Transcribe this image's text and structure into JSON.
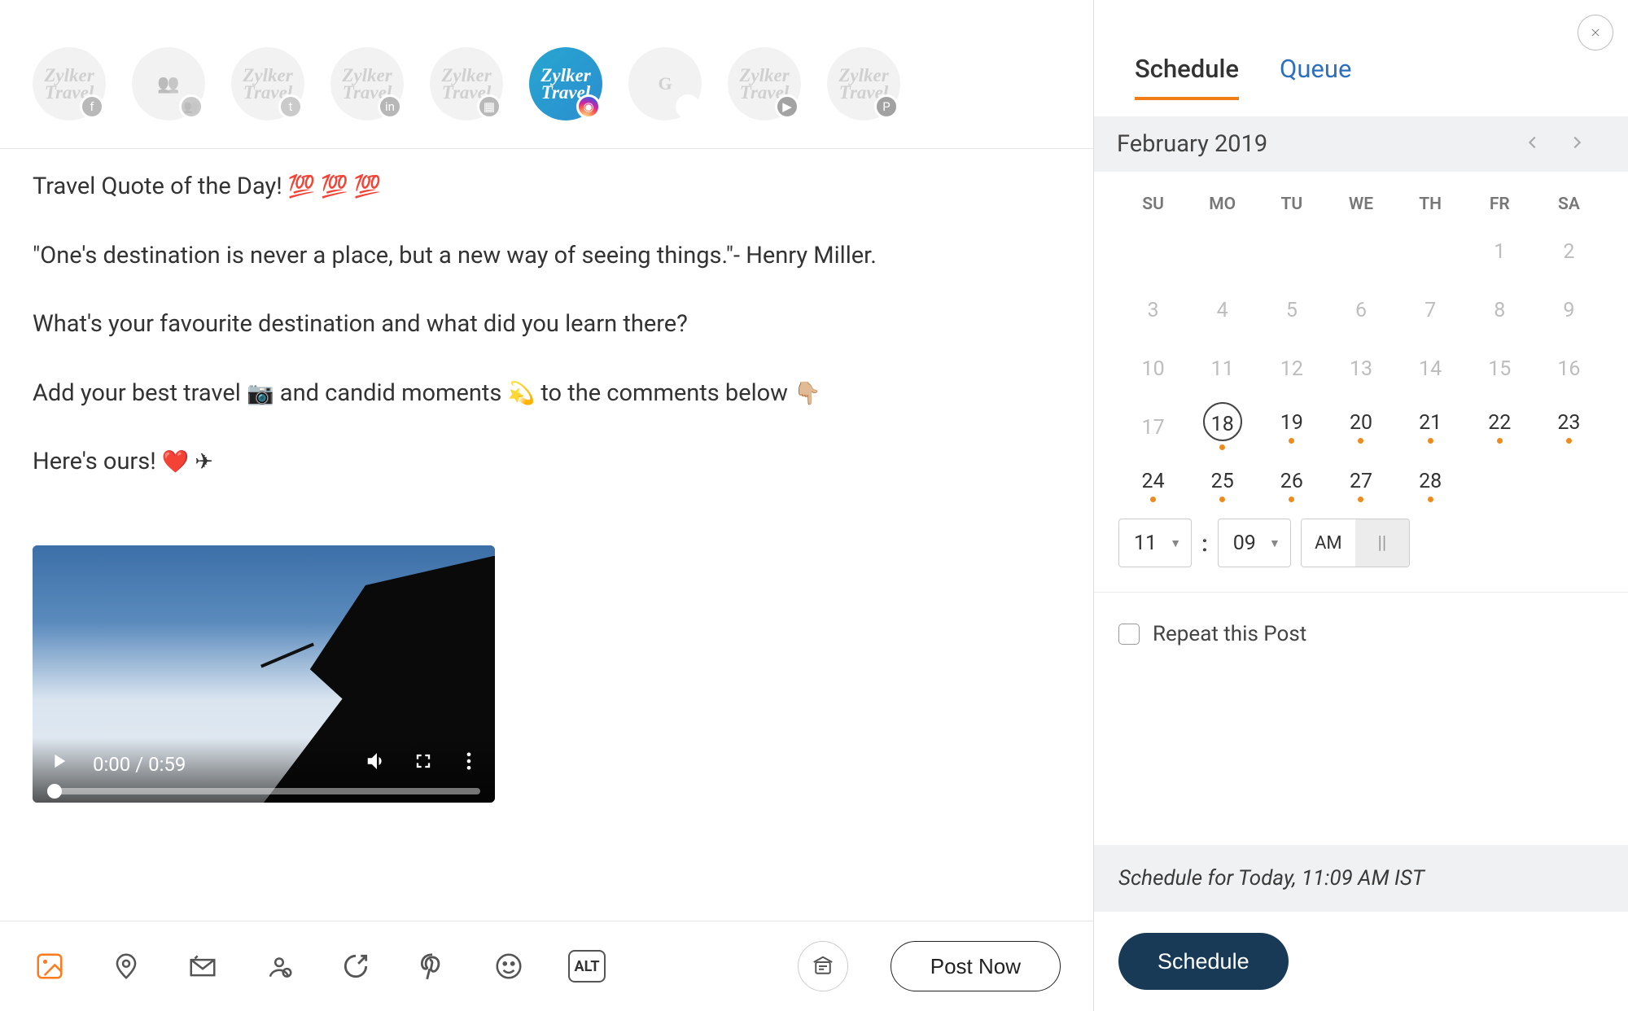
{
  "channels": [
    {
      "name": "Zylker Travel",
      "net": "fb"
    },
    {
      "name": "",
      "net": "grp"
    },
    {
      "name": "Zylker Travel",
      "net": "tw"
    },
    {
      "name": "Zylker Travel",
      "net": "in"
    },
    {
      "name": "Zylker Travel",
      "net": "fbp"
    },
    {
      "name": "Zylker Travel",
      "net": "ig"
    },
    {
      "name": "",
      "net": "gg"
    },
    {
      "name": "Zylker Travel",
      "net": "yt"
    },
    {
      "name": "Zylker Travel",
      "net": "pin"
    }
  ],
  "active_channel_index": 5,
  "compose": {
    "line1_a": "Travel Quote of the Day! ",
    "line1_b": "💯 💯 💯",
    "line2": "\"One's destination is never a place, but a new way of seeing things.\"- Henry Miller.",
    "line3": "What's your favourite destination and what did you learn there?",
    "line4_a": "Add your best travel ",
    "line4_b": "📷",
    "line4_c": "  and candid moments ",
    "line4_d": "💫",
    "line4_e": " to the comments below ",
    "line4_f": "👇🏼",
    "line5_a": "Here's ours! ",
    "line5_b": "❤️ ✈"
  },
  "video": {
    "time": "0:00 / 0:59"
  },
  "toolbar": {
    "alt_label": "ALT",
    "post_now": "Post Now"
  },
  "tabs": {
    "schedule": "Schedule",
    "queue": "Queue"
  },
  "calendar": {
    "month_label": "February 2019",
    "dow": [
      "SU",
      "MO",
      "TU",
      "WE",
      "TH",
      "FR",
      "SA"
    ],
    "weeks": [
      [
        {
          "d": "",
          "dim": true
        },
        {
          "d": "",
          "dim": true
        },
        {
          "d": "",
          "dim": true
        },
        {
          "d": "",
          "dim": true
        },
        {
          "d": "",
          "dim": true
        },
        {
          "d": "1",
          "dim": true
        },
        {
          "d": "2",
          "dim": true
        }
      ],
      [
        {
          "d": "3",
          "dim": true
        },
        {
          "d": "4",
          "dim": true
        },
        {
          "d": "5",
          "dim": true
        },
        {
          "d": "6",
          "dim": true
        },
        {
          "d": "7",
          "dim": true
        },
        {
          "d": "8",
          "dim": true
        },
        {
          "d": "9",
          "dim": true
        }
      ],
      [
        {
          "d": "10",
          "dim": true
        },
        {
          "d": "11",
          "dim": true
        },
        {
          "d": "12",
          "dim": true
        },
        {
          "d": "13",
          "dim": true
        },
        {
          "d": "14",
          "dim": true
        },
        {
          "d": "15",
          "dim": true
        },
        {
          "d": "16",
          "dim": true
        }
      ],
      [
        {
          "d": "17",
          "dim": true
        },
        {
          "d": "18",
          "sel": true,
          "dot": true
        },
        {
          "d": "19",
          "dot": true
        },
        {
          "d": "20",
          "dot": true
        },
        {
          "d": "21",
          "dot": true
        },
        {
          "d": "22",
          "dot": true
        },
        {
          "d": "23",
          "dot": true
        }
      ],
      [
        {
          "d": "24",
          "dot": true
        },
        {
          "d": "25",
          "dot": true
        },
        {
          "d": "26",
          "dot": true
        },
        {
          "d": "27",
          "dot": true
        },
        {
          "d": "28",
          "dot": true
        },
        {
          "d": ""
        },
        {
          "d": ""
        }
      ]
    ]
  },
  "time": {
    "hour": "11",
    "minute": "09",
    "am": "AM",
    "pm": "||"
  },
  "repeat_label": "Repeat this Post",
  "summary_text": "Schedule for Today, 11:09 AM  IST",
  "schedule_btn": "Schedule"
}
